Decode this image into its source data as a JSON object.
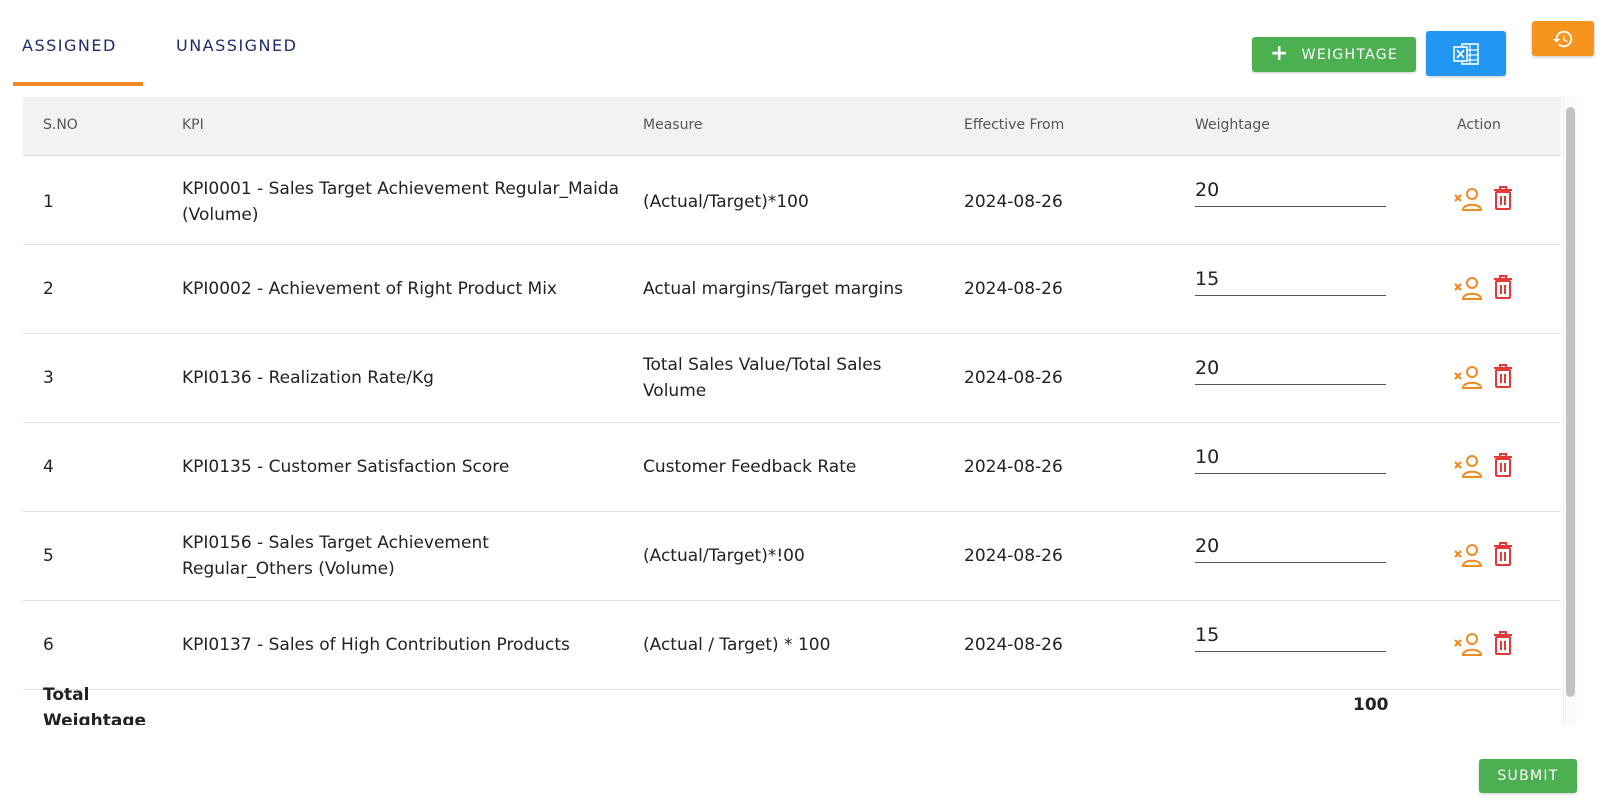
{
  "tabs": [
    {
      "label": "ASSIGNED",
      "active": true
    },
    {
      "label": "UNASSIGNED",
      "active": false
    }
  ],
  "toolbar": {
    "add_weightage_label": "WEIGHTAGE",
    "add_weightage_icon": "plus-icon",
    "excel_icon": "excel-icon",
    "history_icon": "history-icon"
  },
  "table": {
    "columns": [
      "S.NO",
      "KPI",
      "Measure",
      "Effective From",
      "Weightage",
      "Action"
    ],
    "rows": [
      {
        "sno": "1",
        "kpi": "KPI0001 - Sales Target Achievement Regular_Maida (Volume)",
        "measure": "(Actual/Target)*100",
        "effective_from": "2024-08-26",
        "weightage": "20"
      },
      {
        "sno": "2",
        "kpi": "KPI0002 - Achievement of Right Product Mix",
        "measure": "Actual margins/Target margins",
        "effective_from": "2024-08-26",
        "weightage": "15"
      },
      {
        "sno": "3",
        "kpi": "KPI0136 - Realization Rate/Kg",
        "measure": "Total Sales Value/Total Sales Volume",
        "effective_from": "2024-08-26",
        "weightage": "20"
      },
      {
        "sno": "4",
        "kpi": "KPI0135 - Customer Satisfaction Score",
        "measure": "Customer Feedback Rate",
        "effective_from": "2024-08-26",
        "weightage": "10"
      },
      {
        "sno": "5",
        "kpi": "KPI0156 - Sales Target Achievement Regular_Others (Volume)",
        "measure": "(Actual/Target)*!00",
        "effective_from": "2024-08-26",
        "weightage": "20"
      },
      {
        "sno": "6",
        "kpi": "KPI0137 - Sales of High Contribution Products",
        "measure": "(Actual / Target) * 100",
        "effective_from": "2024-08-26",
        "weightage": "15"
      }
    ],
    "action_icons": [
      "remove-user-icon",
      "trash-icon"
    ],
    "total_label": "Total Weightage",
    "total_value": "100"
  },
  "submit_label": "SUBMIT",
  "colors": {
    "tab_text": "#1f2a6b",
    "tab_indicator": "#f08a24",
    "green": "#4caf50",
    "blue": "#2196f3",
    "orange": "#f7941d",
    "action_orange": "#f08a24",
    "delete_red": "#e53935"
  }
}
